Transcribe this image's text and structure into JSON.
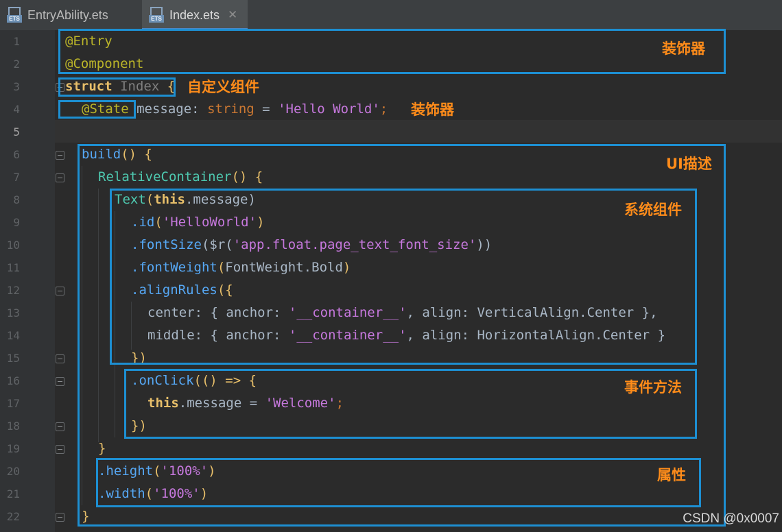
{
  "tabs": [
    {
      "label": "EntryAbility.ets",
      "icon": "ets-file-icon",
      "active": false
    },
    {
      "label": "Index.ets",
      "icon": "ets-file-icon",
      "active": true,
      "close": "✕"
    }
  ],
  "tab_icon_text": "ETS",
  "lines": [
    "1",
    "2",
    "3",
    "4",
    "5",
    "6",
    "7",
    "8",
    "9",
    "10",
    "11",
    "12",
    "13",
    "14",
    "15",
    "16",
    "17",
    "18",
    "19",
    "20",
    "21",
    "22"
  ],
  "code": {
    "l1": "@Entry",
    "l2": "@Component",
    "l3_kw": "struct",
    "l3_name": "Index",
    "l3_br": "{",
    "l4_ann": "@State",
    "l4_name": "message",
    "l4_colon": ":",
    "l4_type": "string",
    "l4_eq": "=",
    "l4_str": "'Hello World'",
    "l4_semi": ";",
    "l6_fn": "build",
    "l6_rest": "() {",
    "l7_fn": "RelativeContainer",
    "l7_rest": "() {",
    "l8_fn": "Text",
    "l8_p1": "(",
    "l8_this": "this",
    "l8_p2": ".message)",
    "l9_fn": ".id",
    "l9_p1": "(",
    "l9_str": "'HelloWorld'",
    "l9_p2": ")",
    "l10_fn": ".fontSize",
    "l10_p1": "($r(",
    "l10_str": "'app.float.page_text_font_size'",
    "l10_p2": "))",
    "l11_fn": ".fontWeight",
    "l11_p1": "(",
    "l11_val": "FontWeight.Bold",
    "l11_p2": ")",
    "l12_fn": ".alignRules",
    "l12_p1": "({",
    "l13_key": "center",
    "l13_a": ": { anchor: ",
    "l13_str": "'__container__'",
    "l13_b": ", align: ",
    "l13_val": "VerticalAlign.Center",
    "l13_c": " },",
    "l14_key": "middle",
    "l14_a": ": { anchor: ",
    "l14_str": "'__container__'",
    "l14_b": ", align: ",
    "l14_val": "HorizontalAlign.Center",
    "l14_c": " }",
    "l15": "})",
    "l16_fn": ".onClick",
    "l16_p1": "(() => {",
    "l17_this": "this",
    "l17_a": ".message = ",
    "l17_str": "'Welcome'",
    "l17_b": ";",
    "l18": "})",
    "l19": "}",
    "l20_fn": ".height",
    "l20_p1": "(",
    "l20_str": "'100%'",
    "l20_p2": ")",
    "l21_fn": ".width",
    "l21_p1": "(",
    "l21_str": "'100%'",
    "l21_p2": ")",
    "l22": "}"
  },
  "annotations": {
    "decorator_top": "装饰器",
    "custom_component": "自定义组件",
    "decorator_state": "装饰器",
    "ui_description": "UI描述",
    "system_component": "系统组件",
    "event_method": "事件方法",
    "attribute": "属性"
  },
  "watermark": "CSDN @0x0007",
  "colors": {
    "annotation_box": "#1d8fd2",
    "annotation_text": "#ff8c1a",
    "editor_bg": "#2b2b2b"
  }
}
